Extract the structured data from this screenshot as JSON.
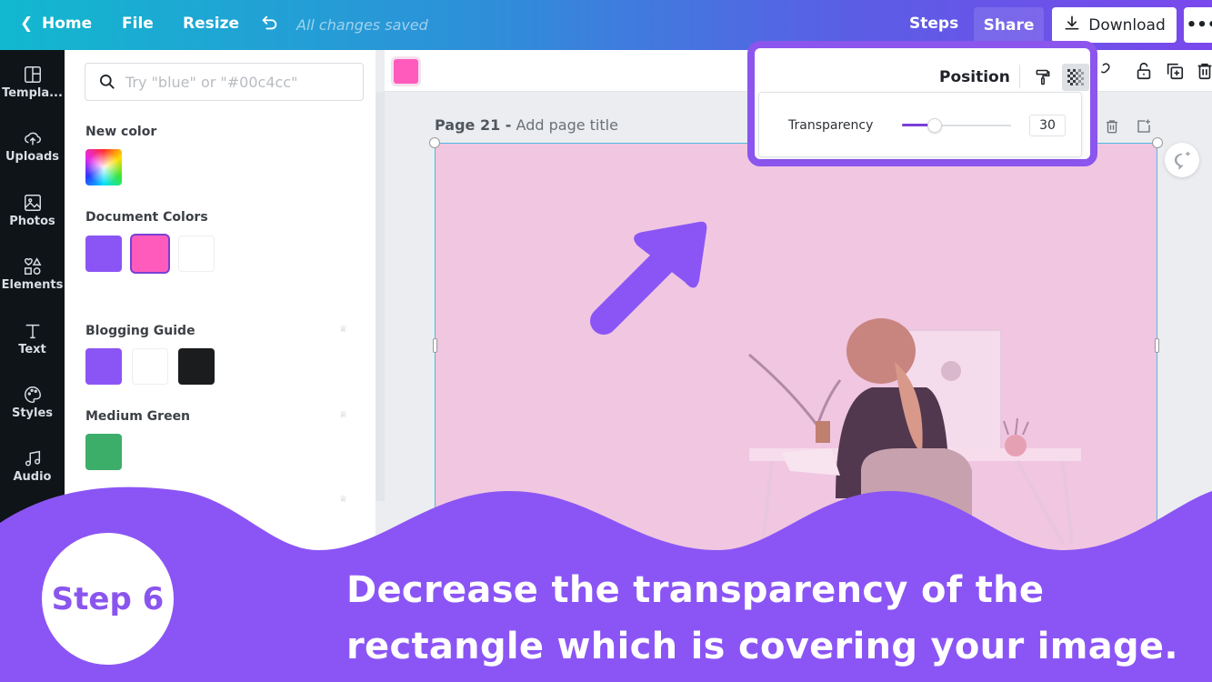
{
  "topbar": {
    "home": "Home",
    "file": "File",
    "resize": "Resize",
    "save_status": "All changes saved",
    "steps": "Steps",
    "share": "Share",
    "download": "Download",
    "more": "•••"
  },
  "rail": {
    "items": [
      {
        "label": "Templa...",
        "icon": "templates-icon"
      },
      {
        "label": "Uploads",
        "icon": "upload-cloud-icon"
      },
      {
        "label": "Photos",
        "icon": "photo-icon"
      },
      {
        "label": "Elements",
        "icon": "shapes-icon"
      },
      {
        "label": "Text",
        "icon": "text-icon"
      },
      {
        "label": "Styles",
        "icon": "palette-icon"
      },
      {
        "label": "Audio",
        "icon": "music-note-icon"
      }
    ]
  },
  "color_panel": {
    "search_placeholder": "Try \"blue\" or \"#00c4cc\"",
    "new_color_title": "New color",
    "document_colors_title": "Document Colors",
    "document_colors": [
      "#8b55f5",
      "#ff5bbd",
      "#ffffff"
    ],
    "selected_document_color": "#ff5bbd",
    "palettes": [
      {
        "title": "Blogging Guide",
        "colors": [
          "#8b55f5",
          "#ffffff",
          "#1b1c1e"
        ]
      },
      {
        "title": "Medium Green",
        "colors": [
          "#3dae6a"
        ]
      }
    ]
  },
  "editor": {
    "fill_color": "#ff5bbd",
    "page_number": "Page 21 -",
    "page_title_placeholder": "Add page title",
    "position_label": "Position",
    "transparency_label": "Transparency",
    "transparency_value": "30",
    "transparency_percent": 30
  },
  "banner": {
    "step": "Step 6",
    "instruction": "Decrease the transparency of the rectangle which is covering your image."
  },
  "colors": {
    "accent_purple": "#8b55ee",
    "canvas_pink": "#f0c6e1"
  }
}
